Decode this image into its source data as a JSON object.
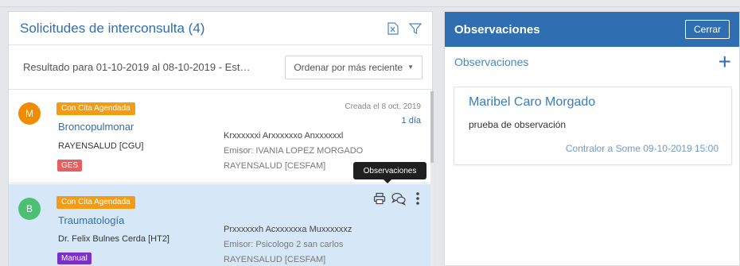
{
  "left_panel": {
    "title": "Solicitudes de interconsulta (4)",
    "icons": [
      "excel-export-icon",
      "filter-icon"
    ],
    "result_text": "Resultado para 01-10-2019 al 08-10-2019 - Esta...",
    "sort_label": "Ordenar por más reciente"
  },
  "items": [
    {
      "avatar": "M",
      "avatar_color": "#f08c00",
      "status": "Con Cita Agendada",
      "specialty": "Broncopulmonar",
      "institution": "RAYENSALUD [CGU]",
      "tag": "GES",
      "tag_color": "#e85d5d",
      "patient": "Krxxxxxxi Arxxxxxxo Anxxxxxxl",
      "emisor": "Emisor: IVANIA LOPEZ MORGADO",
      "origin": "RAYENSALUD [CESFAM]",
      "created": "Creada el 8 oct. 2019",
      "days": "1 día"
    },
    {
      "avatar": "B",
      "avatar_color": "#4bbf73",
      "status": "Con Cita Agendada",
      "specialty": "Traumatología",
      "institution": "Dr. Felix Bulnes Cerda [HT2]",
      "tag": "Manual",
      "tag_color": "#7b2fc9",
      "patient": "Prxxxxxxh Acxxxxxxa Muxxxxxxz",
      "emisor": "Emisor: Psicologo 2 san carlos",
      "origin": "RAYENSALUD [CESFAM]"
    }
  ],
  "tooltip": "Observaciones",
  "right_panel": {
    "title": "Observaciones",
    "close_label": "Cerrar",
    "section_label": "Observaciones",
    "observation": {
      "author": "Maribel Caro Morgado",
      "text": "prueba de observación",
      "footer": "Contralor a Some 09-10-2019 15:00"
    }
  },
  "colors": {
    "primary": "#2f6fb1",
    "status_badge": "#f39c12",
    "selected_row": "#d6e8f7"
  }
}
